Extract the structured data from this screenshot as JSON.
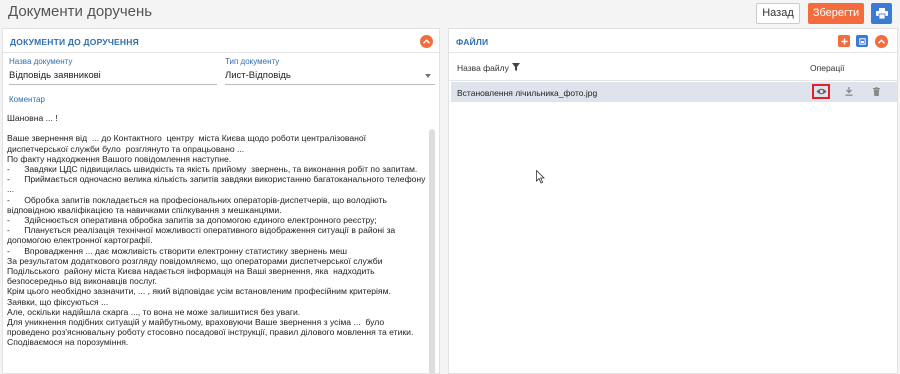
{
  "header": {
    "title": "Документи доручень",
    "back_label": "Назад",
    "save_label": "Зберегти"
  },
  "left_panel": {
    "title": "ДОКУМЕНТИ ДО ДОРУЧЕННЯ",
    "doc_name_label": "Назва документу",
    "doc_name_value": "Відповідь заявникові",
    "doc_type_label": "Тип документу",
    "doc_type_value": "Лист-Відповідь",
    "comment_label": "Коментар",
    "comment_text": "Шановна ... !\n\nВаше звернення від  ... до Контактного  центру  міста Києва щодо роботи централізованої диспетчерської служби було  розглянуто та опрацьовано ...\nПо факту надходження Вашого повідомлення наступне.\n-      Завдяки ЦДС підвищилась швидкість та якість прийому  звернень, та виконання робіт по запитам.\n-      Приймається одночасно велика кількість запитів завдяки використанню багатоканального телефону ...\n-      Обробка запитів покладається на професіональних операторів-диспетчерів, що володіють відповідною кваліфікацією та навичками спілкування з мешканцями.\n-      Здійснюється оперативна обробка запитів за допомогою єдиного електронного реєстру;\n-      Планується реалізація технічної можливості оперативного відображення ситуації в районі за допомогою електронної картографії.\n-      Впровадження ... дає можливість створити електронну статистику звернень меш\nЗа результатом додаткового розгляду повідомляємо, що операторами диспетчерської служби Подільського  району міста Києва надається інформація на Ваші звернення, яка  надходить безпосередньо від виконавців послуг.\nКрім цього необхідно зазначити, ... , який відповідає усім встановленим професійним критеріям.\nЗаявки, що фіксуються ...\nАле, оскільки надійшла скарга ..., то вона не може залишитися без уваги.\nДля уникнення подібних ситуацій у майбутньому, враховуючи Ваше звернення з усіма ...  було проведено роз'яснювальну роботу стосовно посадової інструкції, правил ділового мовлення та етики.\nСподіваємося на порозуміння."
  },
  "right_panel": {
    "title": "ФАЙЛИ",
    "col_file_name": "Назва файлу",
    "col_operations": "Операції",
    "files": [
      {
        "name": "Встановлення лічильника_фото.jpg"
      }
    ]
  },
  "icons": {
    "print": "printer-icon",
    "collapse": "chevron-up-icon",
    "add": "plus-icon",
    "upload": "upload-icon",
    "filter": "filter-icon",
    "view": "eye-icon",
    "download": "download-icon",
    "delete": "trash-icon",
    "dropdown": "caret-down-icon"
  },
  "colors": {
    "accent_orange": "#f26c3e",
    "accent_blue": "#3b7bd4",
    "label_blue": "#2f6fae",
    "highlight_red": "#e0232b",
    "selected_row": "#dfe4ec"
  }
}
